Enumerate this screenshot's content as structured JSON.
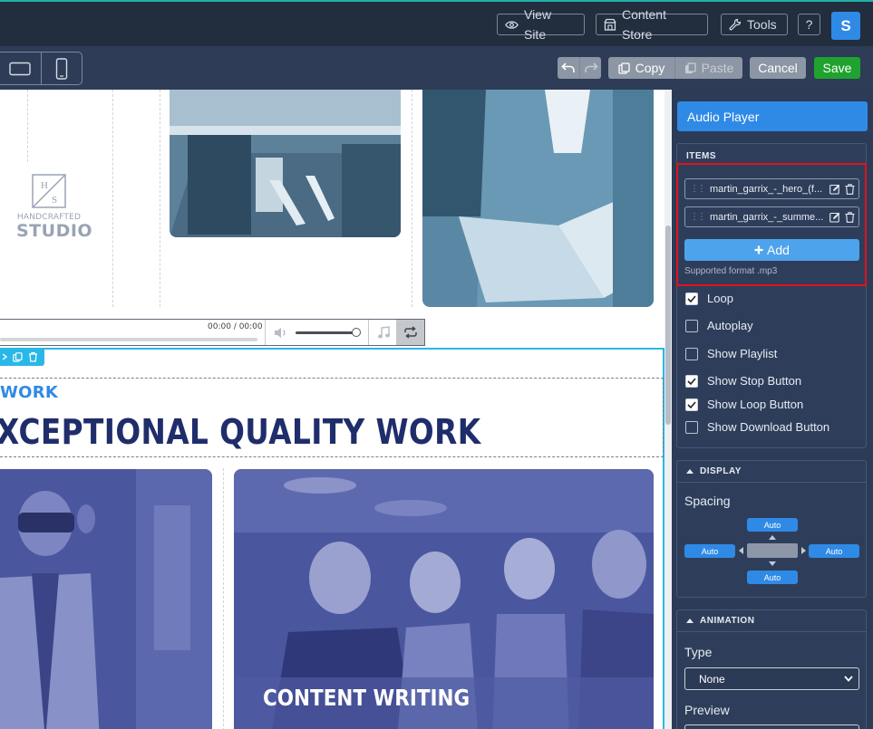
{
  "topbar": {
    "view_site": "View Site",
    "content_store": "Content Store",
    "tools": "Tools",
    "help": "?",
    "avatar_initial": "S"
  },
  "toolbar": {
    "copy": "Copy",
    "paste": "Paste",
    "cancel": "Cancel",
    "save": "Save"
  },
  "canvas": {
    "logo_line1": "HANDCRAFTED",
    "logo_line2": "STUDIO",
    "logo_monogram_top": "H",
    "logo_monogram_bottom": "S",
    "player_time": "00:00 / 00:00",
    "section_kicker": "WORK",
    "section_heading": "XCEPTIONAL QUALITY WORK",
    "card_caption": "CONTENT WRITING"
  },
  "panel": {
    "header": "Audio Player",
    "items_title": "ITEMS",
    "items": [
      {
        "label": "martin_garrix_-_hero_(f..."
      },
      {
        "label": "martin_garrix_-_summe..."
      }
    ],
    "add_label": "Add",
    "supported_format": "Supported format .mp3",
    "options": [
      {
        "label": "Loop",
        "checked": true
      },
      {
        "label": "Autoplay",
        "checked": false
      },
      {
        "label": "Show Playlist",
        "checked": false
      },
      {
        "label": "Show Stop Button",
        "checked": true
      },
      {
        "label": "Show Loop Button",
        "checked": true
      },
      {
        "label": "Show Download Button",
        "checked": false
      }
    ],
    "display_title": "DISPLAY",
    "spacing_label": "Spacing",
    "spacing": {
      "top": "Auto",
      "left": "Auto",
      "right": "Auto",
      "bottom": "Auto"
    },
    "animation_title": "ANIMATION",
    "type_label": "Type",
    "type_value": "None",
    "preview_label": "Preview"
  },
  "colors": {
    "accent": "#2f8ae6",
    "save_green": "#1fa32e",
    "highlight_red": "#e0121e",
    "panel_bg": "#2c3b56",
    "heading_navy": "#1f2d6b"
  }
}
